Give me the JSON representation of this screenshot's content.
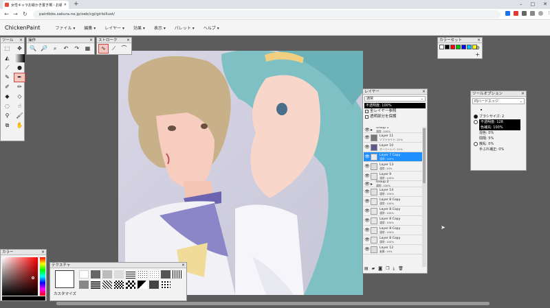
{
  "browser": {
    "tab_title": "女性キャラお絵かき置き場 - お絵かき掲示板",
    "new_tab_symbol": "+",
    "url": "paintbbs.sakura.ne.jp/oeb/cgi/girlsillust/",
    "window_controls": [
      "–",
      "□",
      "✕"
    ]
  },
  "app": {
    "title": "ChickenPaint",
    "menu": [
      "ファイル ▾",
      "編集 ▾",
      "レイヤー ▾",
      "効果 ▾",
      "表示 ▾",
      "パレット ▾",
      "ヘルプ ▾"
    ]
  },
  "tools_panel": {
    "title": "ツール",
    "close": "×",
    "tools": [
      "select-rect-icon",
      "move-icon",
      "fill-bucket-icon",
      "gradient-icon",
      "eyedropper-icon",
      "water-drop-icon",
      "pencil-icon",
      "pen-icon",
      "airbrush-icon",
      "marker-icon",
      "eraser-icon",
      "soft-eraser-icon",
      "blur-icon",
      "smudge-icon",
      "dodge-icon",
      "brush-icon",
      "rotate-icon",
      "hand-icon"
    ],
    "selected_index": 7
  },
  "ops_panel": {
    "title": "操作",
    "close": "×",
    "buttons": [
      "zoom-in-icon",
      "zoom-out-icon",
      "zoom-100-icon",
      "undo-icon",
      "redo-icon",
      "save-icon"
    ]
  },
  "stroke_panel": {
    "title": "ストローク",
    "close": "×",
    "buttons": [
      "freehand-stroke-icon",
      "line-stroke-icon",
      "bezier-stroke-icon"
    ]
  },
  "swatch_panel": {
    "title": "カラーセット",
    "close": "×",
    "colors": [
      "#ffffff",
      "#000000",
      "#ff0000",
      "#00c000",
      "#0000ff",
      "#00c0ff",
      "#ffff00"
    ],
    "gear_icon": "gear-icon",
    "plus": "+"
  },
  "layers_panel": {
    "title": "レイヤー",
    "close": "×",
    "blend_mode": "通常",
    "opacity": "不透明度: 100%",
    "checkbox_all_layers": "全レイヤー参照",
    "checkbox_lock_alpha": "透明部分を保護",
    "layers": [
      {
        "name": "Group 1",
        "sub": "通常: 100%",
        "group": true,
        "active": false
      },
      {
        "name": "Layer 11",
        "sub": "ソフトライト: 22%",
        "group": false,
        "active": false,
        "thumb": "#777777"
      },
      {
        "name": "Layer 10",
        "sub": "オーバーレイ: 21%",
        "group": false,
        "active": false,
        "thumb": "#5a5a8a"
      },
      {
        "name": "Layer 7 Copy",
        "sub": "通常: 100%",
        "group": false,
        "active": true,
        "thumb": "#e8e8f0"
      },
      {
        "name": "Layer 13",
        "sub": "通常: 20%",
        "group": false,
        "active": false,
        "thumb": "#dddddd"
      },
      {
        "name": "Layer 9",
        "sub": "通常: 100%",
        "group": false,
        "active": false,
        "thumb": "#e4e4e4"
      },
      {
        "name": "Group 2",
        "sub": "通常: 100%",
        "group": true,
        "active": false
      },
      {
        "name": "Layer 14",
        "sub": "通常: 100%",
        "group": false,
        "active": false,
        "thumb": "#e0e0e0"
      },
      {
        "name": "Layer 8 Copy",
        "sub": "通常: 100%",
        "group": false,
        "active": false,
        "thumb": "#e6e6e6"
      },
      {
        "name": "Layer 8 Copy",
        "sub": "通常: 100%",
        "group": false,
        "active": false,
        "thumb": "#e6e6e6"
      },
      {
        "name": "Layer 8 Copy",
        "sub": "通常: 100%",
        "group": false,
        "active": false,
        "thumb": "#e6e6e6"
      },
      {
        "name": "Layer 8 Copy",
        "sub": "通常: 100%",
        "group": false,
        "active": false,
        "thumb": "#e6e6e6"
      },
      {
        "name": "Layer 8 Copy",
        "sub": "通常: 100%",
        "group": false,
        "active": false,
        "thumb": "#e6e6e6"
      },
      {
        "name": "Layer 12",
        "sub": "乗算: 19%",
        "group": false,
        "active": false,
        "thumb": "#dcdcdc"
      }
    ],
    "bottom_buttons": [
      "add-layer-icon",
      "add-folder-icon",
      "mask-icon",
      "copy-layer-icon",
      "merge-layer-icon",
      "delete-layer-icon"
    ]
  },
  "tool_options": {
    "title": "ツールオプション",
    "close": "×",
    "brush_tip": "円ハードエッジ",
    "brush_size": "ブラシサイズ: 2",
    "opacity": "不透明度: 128",
    "color_mix": "色補充: 100%",
    "blend": "混色: 0%",
    "spacing": "間隔: 5%",
    "scatter": "散乱: 0%",
    "smoothing": "手ぶれ補正: 0%"
  },
  "color_panel": {
    "title": "カラー",
    "close": "×",
    "current_color": "#000000"
  },
  "texture_panel": {
    "title": "テクスチャ",
    "close": "×",
    "customize": "カスタマイズ"
  }
}
